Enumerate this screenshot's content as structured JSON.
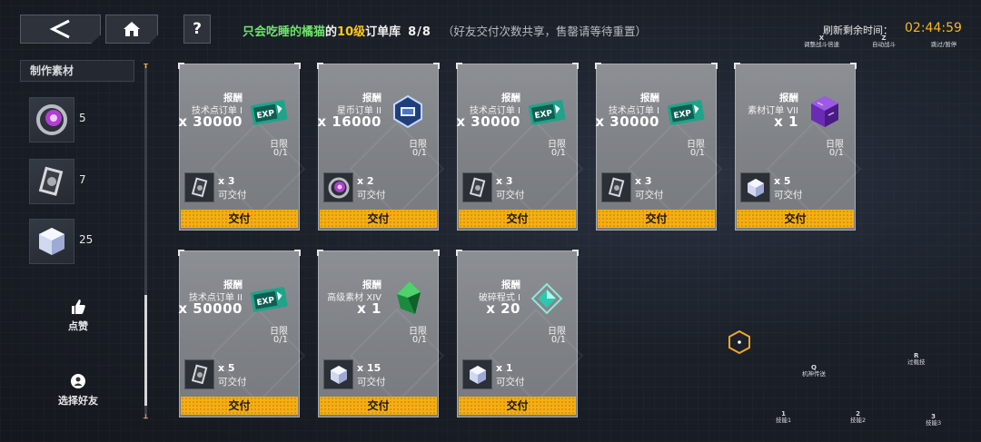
{
  "header": {
    "help_label": "?",
    "title_owner": "只会吃睡的橘猫",
    "title_of": "的",
    "title_level": "10级",
    "title_suffix": "订单库",
    "title_count": "8/8",
    "title_note": "（好友交付次数共享，售罄请等待重置）",
    "refresh_label": "刷新剩余时间：",
    "refresh_value": "02:44:59"
  },
  "hints": [
    {
      "key": "X",
      "label": "调整战斗倍速"
    },
    {
      "key": "Z",
      "label": "自动战斗"
    },
    {
      "key": "ESC",
      "label": "跳过/暂停"
    },
    {
      "key": "Q",
      "label": "机神传送"
    },
    {
      "key": "R",
      "label": "过载技"
    },
    {
      "key": "1",
      "label": "技能1"
    },
    {
      "key": "2",
      "label": "技能2"
    },
    {
      "key": "3",
      "label": "技能3"
    }
  ],
  "sidebar": {
    "tab_label": "制作素材",
    "materials": [
      {
        "name": "purple-orb-material",
        "count": "5"
      },
      {
        "name": "data-chip-material",
        "count": "7"
      },
      {
        "name": "crystal-cube-material",
        "count": "25"
      }
    ],
    "scroll_top_mark": "T",
    "scroll_bottom_mark": "⊥",
    "like_label": "点赞",
    "select_friend_label": "选择好友"
  },
  "cards": [
    {
      "reward_label": "报酬",
      "reward_name": "技术点订单 I",
      "reward_qty": "x 30000",
      "reward_icon": "exp-ticket",
      "limit_label": "日限",
      "limit_value": "0/1",
      "req_icon": "data-chip",
      "req_qty": "x 3",
      "req_status": "可交付",
      "button": "交付"
    },
    {
      "reward_label": "报酬",
      "reward_name": "星币订单 II",
      "reward_qty": "x 16000",
      "reward_icon": "star-coin",
      "limit_label": "日限",
      "limit_value": "0/1",
      "req_icon": "purple-orb",
      "req_qty": "x 2",
      "req_status": "可交付",
      "button": "交付"
    },
    {
      "reward_label": "报酬",
      "reward_name": "技术点订单 I",
      "reward_qty": "x 30000",
      "reward_icon": "exp-ticket",
      "limit_label": "日限",
      "limit_value": "0/1",
      "req_icon": "data-chip",
      "req_qty": "x 3",
      "req_status": "可交付",
      "button": "交付"
    },
    {
      "reward_label": "报酬",
      "reward_name": "技术点订单 I",
      "reward_qty": "x 30000",
      "reward_icon": "exp-ticket",
      "limit_label": "日限",
      "limit_value": "0/1",
      "req_icon": "data-chip",
      "req_qty": "x 3",
      "req_status": "可交付",
      "button": "交付"
    },
    {
      "reward_label": "报酬",
      "reward_name": "素材订单 VII",
      "reward_qty": "x 1",
      "reward_icon": "purple-cube",
      "limit_label": "日限",
      "limit_value": "0/1",
      "req_icon": "crystal-cube",
      "req_qty": "x 5",
      "req_status": "可交付",
      "button": "交付"
    },
    {
      "reward_label": "报酬",
      "reward_name": "技术点订单 II",
      "reward_qty": "x 50000",
      "reward_icon": "exp-ticket",
      "limit_label": "日限",
      "limit_value": "0/1",
      "req_icon": "data-chip",
      "req_qty": "x 5",
      "req_status": "可交付",
      "button": "交付"
    },
    {
      "reward_label": "报酬",
      "reward_name": "高级素材 XIV",
      "reward_qty": "x 1",
      "reward_icon": "green-crystal",
      "limit_label": "日限",
      "limit_value": "0/1",
      "req_icon": "crystal-cube",
      "req_qty": "x 15",
      "req_status": "可交付",
      "button": "交付"
    },
    {
      "reward_label": "报酬",
      "reward_name": "破碎程式 I",
      "reward_qty": "x 20",
      "reward_icon": "teal-shard",
      "limit_label": "日限",
      "limit_value": "0/1",
      "req_icon": "crystal-cube",
      "req_qty": "x 1",
      "req_status": "可交付",
      "button": "交付"
    }
  ],
  "colors": {
    "accent": "#f7ae12",
    "title_green": "#6fe36d",
    "level_yellow": "#ffc81a",
    "timer": "#ffb51a"
  }
}
